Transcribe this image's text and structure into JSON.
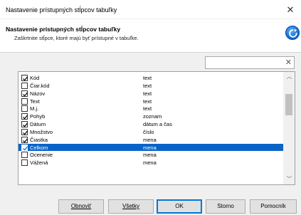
{
  "window": {
    "title": "Nastavenie prístupných stĺpcov tabuľky"
  },
  "header": {
    "title": "Nastavenie prístupných stĺpcov tabuľky",
    "subtitle": "Zaškrtnite stĺpce, ktoré majú byť prístupné v tabuľke.",
    "icon": "blue-circle-refresh-icon",
    "accent": "#1a73d6"
  },
  "search": {
    "value": "",
    "placeholder": ""
  },
  "columns": [
    {
      "name": "Kód",
      "type": "text",
      "checked": true,
      "selected": false
    },
    {
      "name": "Čiar.kód",
      "type": "text",
      "checked": false,
      "selected": false
    },
    {
      "name": "Názov",
      "type": "text",
      "checked": true,
      "selected": false
    },
    {
      "name": "Text",
      "type": "text",
      "checked": false,
      "selected": false
    },
    {
      "name": "M.j.",
      "type": "text",
      "checked": false,
      "selected": false
    },
    {
      "name": "Pohyb",
      "type": "zoznam",
      "checked": true,
      "selected": false
    },
    {
      "name": "Dátum",
      "type": "dátum a čas",
      "checked": true,
      "selected": false
    },
    {
      "name": "Množstvo",
      "type": "číslo",
      "checked": true,
      "selected": false
    },
    {
      "name": "Čiastka",
      "type": "mena",
      "checked": true,
      "selected": false
    },
    {
      "name": "Celkom",
      "type": "mena",
      "checked": true,
      "selected": true
    },
    {
      "name": "Ocenenie",
      "type": "mena",
      "checked": false,
      "selected": false
    },
    {
      "name": "Vážená",
      "type": "mena",
      "checked": false,
      "selected": false
    }
  ],
  "buttons": {
    "refresh": "Obnoviť",
    "all": "Všetky",
    "ok": "OK",
    "cancel": "Storno",
    "help": "Pomocník"
  },
  "colors": {
    "selection": "#0a64c8",
    "ok_border": "#0078d7"
  }
}
